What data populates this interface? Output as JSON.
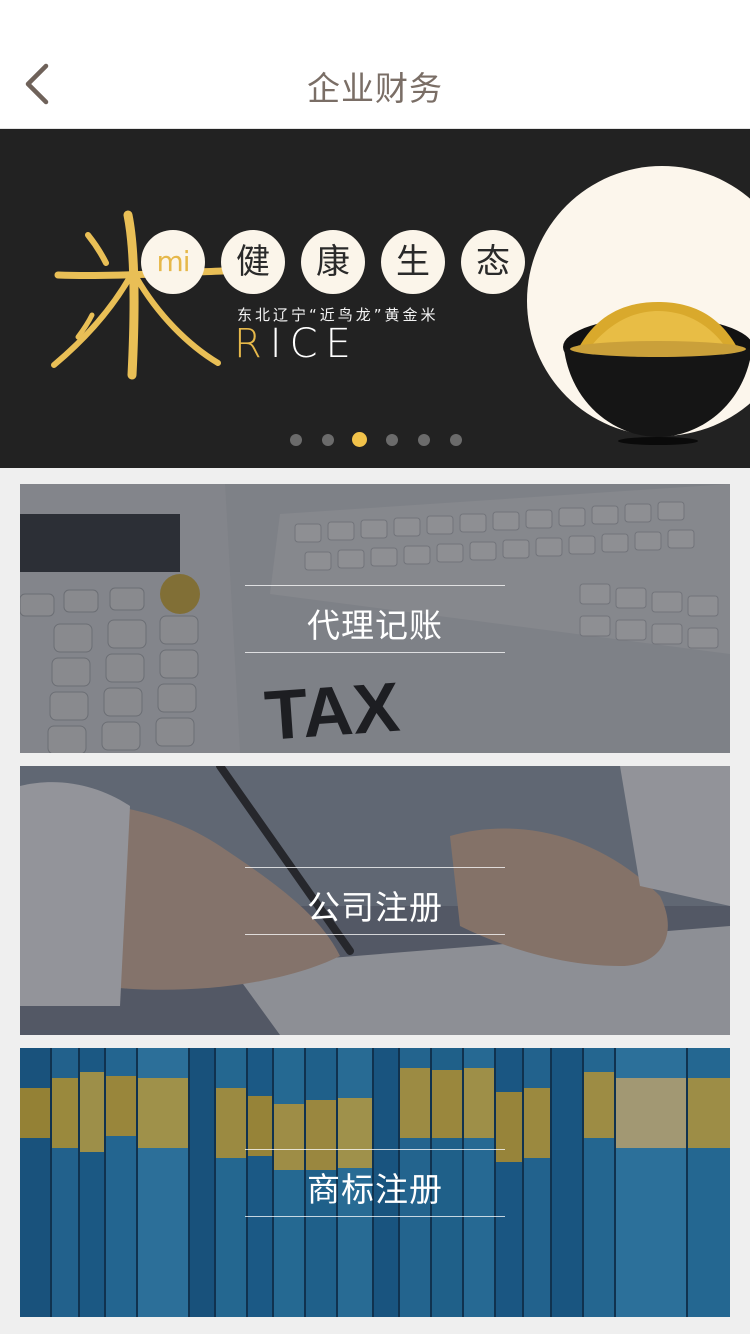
{
  "header": {
    "title": "企业财务",
    "back_icon": "chevron-left-icon"
  },
  "banner": {
    "logo_char": "米",
    "pinyin": "mi",
    "slogan_chars": [
      "健",
      "康",
      "生",
      "态"
    ],
    "subtitle": "东北辽宁“近鸟龙”黄金米",
    "rice_first": "R",
    "rice_rest": "ICE",
    "accent_color": "#e6b84a",
    "dots_total": 6,
    "active_dot_index": 2
  },
  "services": [
    {
      "label": "代理记账",
      "image": "calculator-tax-keyboard"
    },
    {
      "label": "公司注册",
      "image": "hand-signing-document"
    },
    {
      "label": "商标注册",
      "image": "blue-file-folders"
    }
  ],
  "colors": {
    "header_text": "#7a6e66",
    "banner_bg": "#222222",
    "active_dot": "#f1c24a",
    "page_bg": "#efefef"
  }
}
